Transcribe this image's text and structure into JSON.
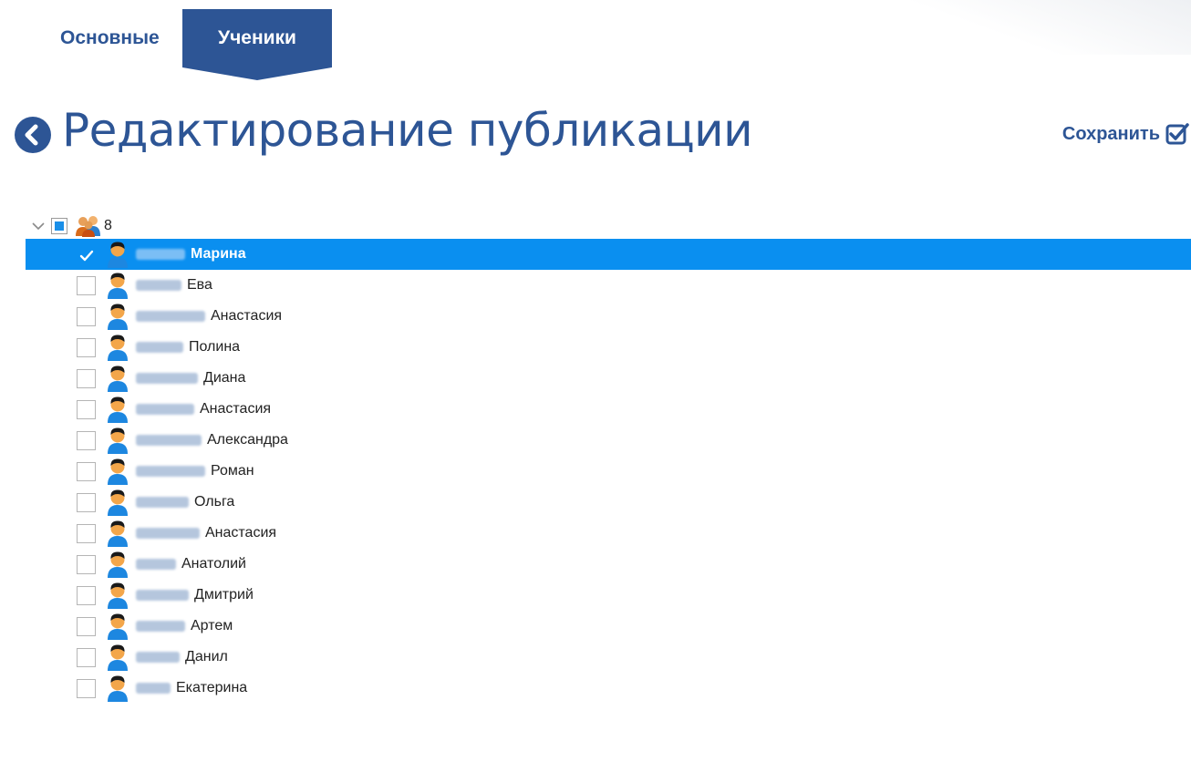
{
  "tabs": [
    {
      "label": "Основные",
      "active": false
    },
    {
      "label": "Ученики",
      "active": true
    }
  ],
  "header": {
    "title": "Редактирование публикации",
    "save_label": "Сохранить",
    "back_icon": "chevron-left-circle-icon",
    "save_icon": "checkbox-checked-icon"
  },
  "tree": {
    "root": {
      "count": "8",
      "expanded": true,
      "state": "partial",
      "icon": "group-icon"
    },
    "students": [
      {
        "first_name": "Марина",
        "checked": true,
        "selected": true
      },
      {
        "first_name": "Ева",
        "checked": false,
        "selected": false
      },
      {
        "first_name": "Анастасия",
        "checked": false,
        "selected": false
      },
      {
        "first_name": "Полина",
        "checked": false,
        "selected": false
      },
      {
        "first_name": "Диана",
        "checked": false,
        "selected": false
      },
      {
        "first_name": "Анастасия",
        "checked": false,
        "selected": false
      },
      {
        "first_name": "Александра",
        "checked": false,
        "selected": false
      },
      {
        "first_name": "Роман",
        "checked": false,
        "selected": false
      },
      {
        "first_name": "Ольга",
        "checked": false,
        "selected": false
      },
      {
        "first_name": "Анастасия",
        "checked": false,
        "selected": false
      },
      {
        "first_name": "Анатолий",
        "checked": false,
        "selected": false
      },
      {
        "first_name": "Дмитрий",
        "checked": false,
        "selected": false
      },
      {
        "first_name": "Артем",
        "checked": false,
        "selected": false
      },
      {
        "first_name": "Данил",
        "checked": false,
        "selected": false
      },
      {
        "first_name": "Екатерина",
        "checked": false,
        "selected": false
      }
    ]
  },
  "colors": {
    "accent": "#2d5595",
    "selection": "#0a8ff0"
  }
}
